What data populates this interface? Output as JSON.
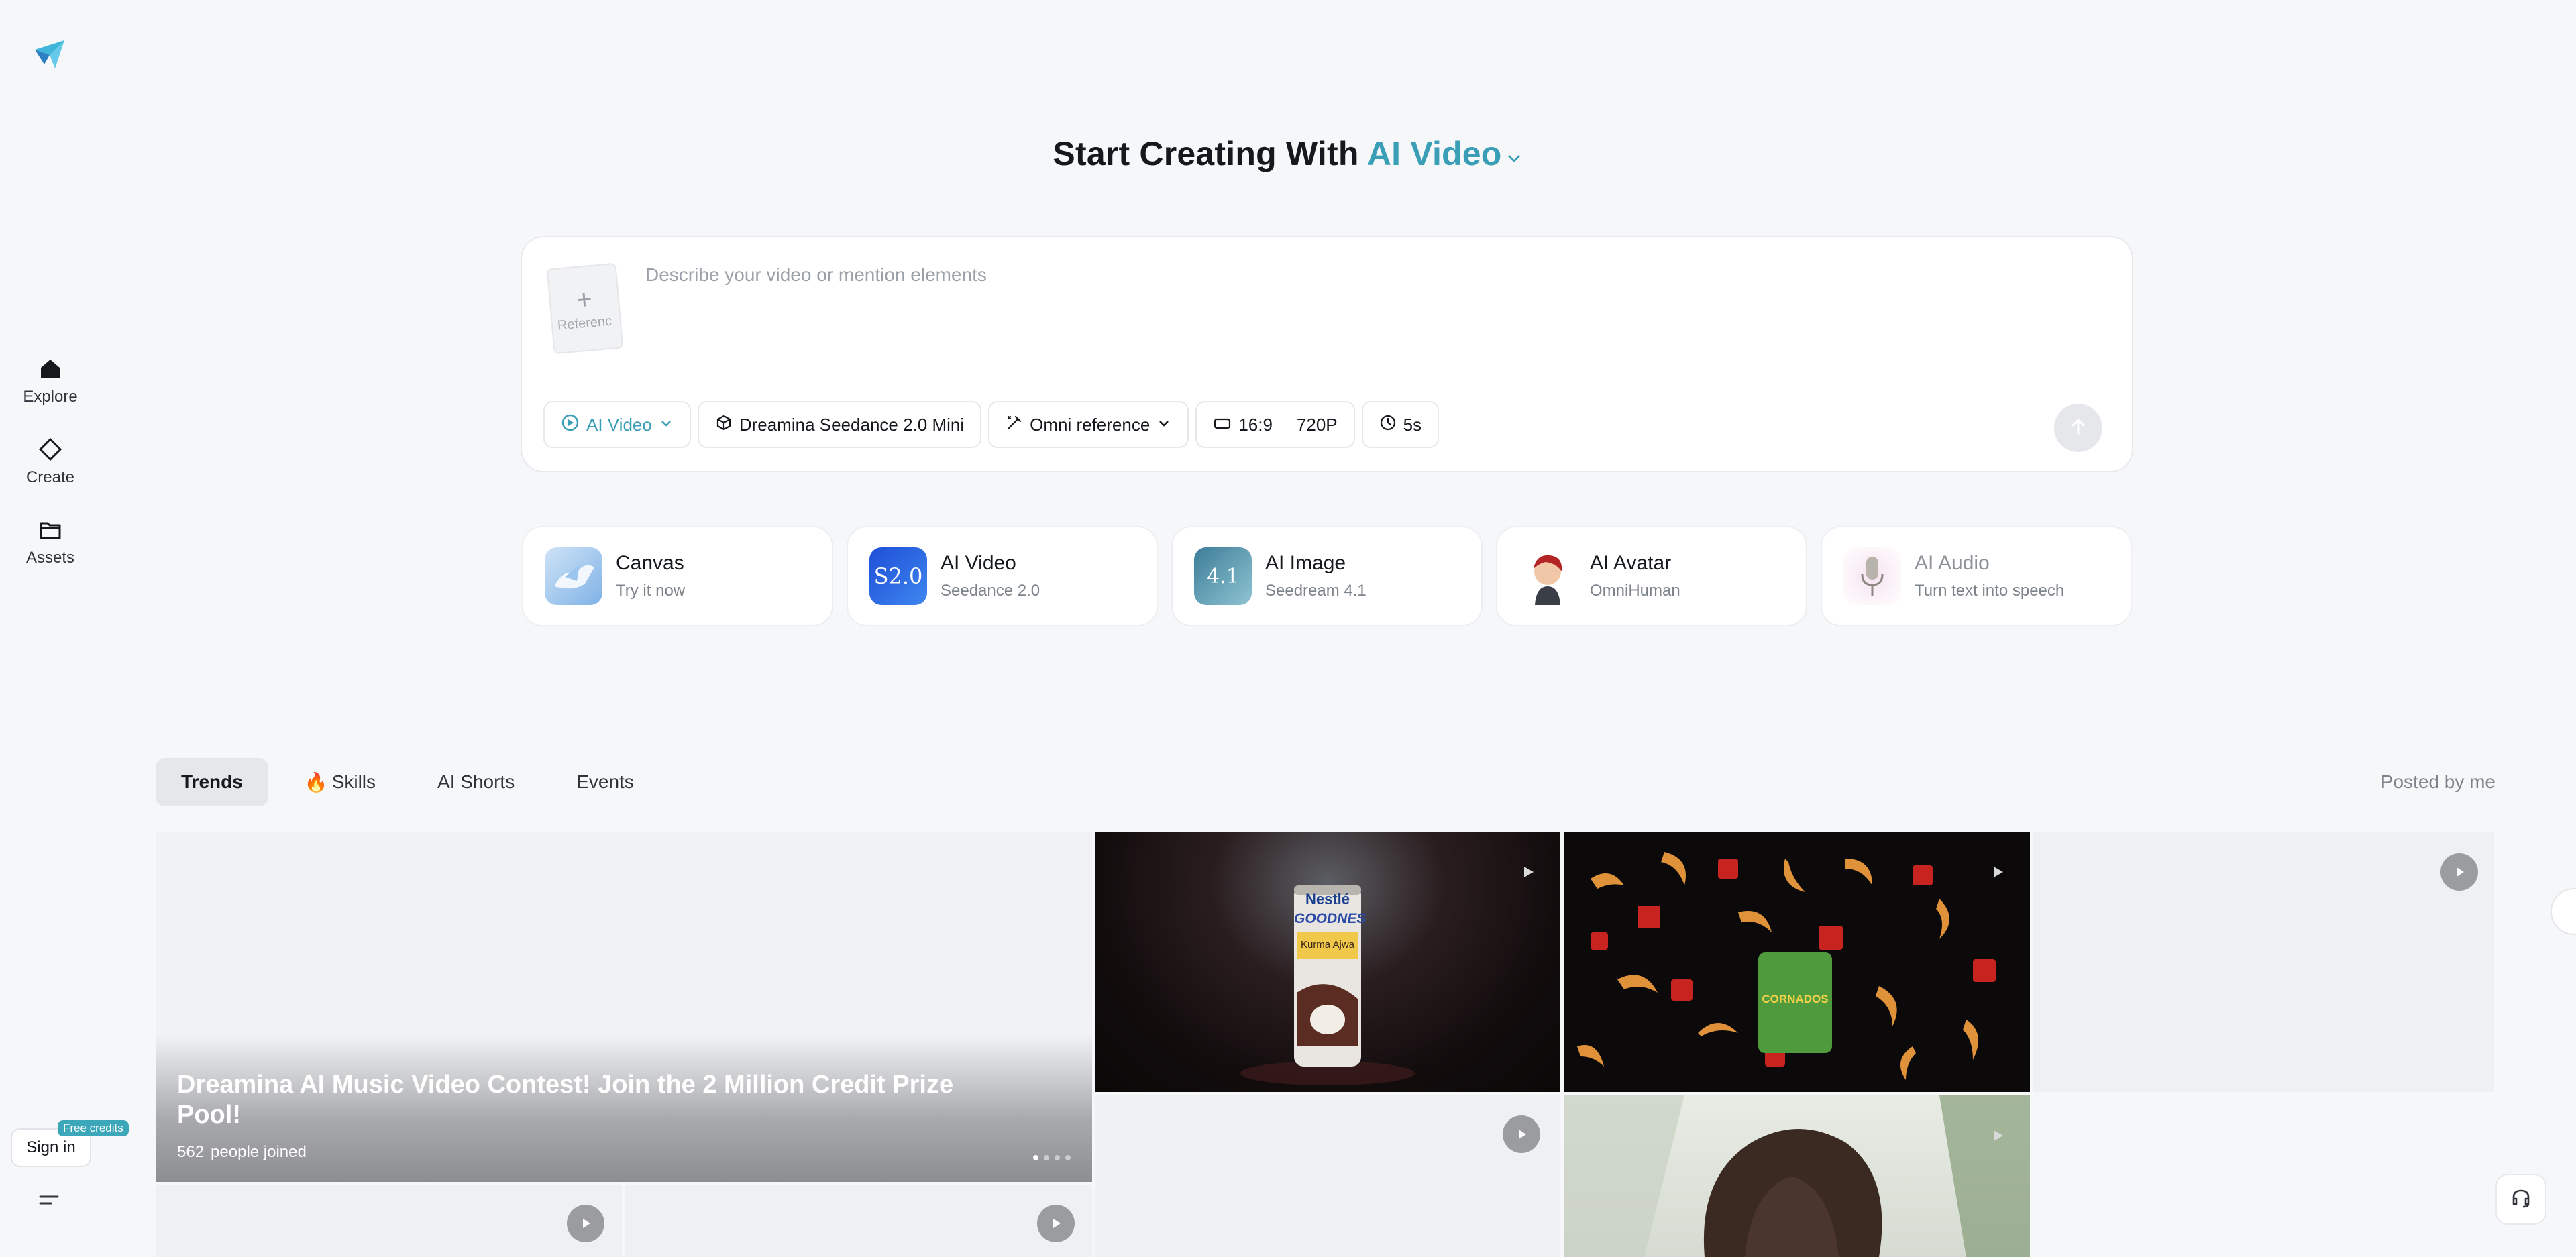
{
  "sidebar": {
    "items": [
      {
        "label": "Explore",
        "icon": "home-icon"
      },
      {
        "label": "Create",
        "icon": "diamond-icon"
      },
      {
        "label": "Assets",
        "icon": "folder-icon"
      }
    ],
    "signin_label": "Sign in",
    "free_badge": "Free credits"
  },
  "header": {
    "title_prefix": "Start Creating With",
    "title_accent": "AI Video"
  },
  "prompt": {
    "placeholder": "Describe your video or mention elements",
    "reference_label": "Referenc",
    "mode": "AI Video",
    "model": "Dreamina Seedance 2.0 Mini",
    "reference_mode": "Omni reference",
    "ratio": "16:9",
    "resolution": "720P",
    "duration": "5s"
  },
  "features": [
    {
      "title": "Canvas",
      "sub": "Try it now"
    },
    {
      "title": "AI Video",
      "sub": "Seedance 2.0",
      "thumb_text": "S2.0"
    },
    {
      "title": "AI Image",
      "sub": "Seedream 4.1",
      "thumb_text": "4.1"
    },
    {
      "title": "AI Avatar",
      "sub": "OmniHuman"
    },
    {
      "title": "AI Audio",
      "sub": "Turn text into speech"
    }
  ],
  "tabs": {
    "items": [
      "Trends",
      "Skills",
      "AI Shorts",
      "Events"
    ],
    "skills_emoji": "🔥",
    "posted_by_me": "Posted by me"
  },
  "banner": {
    "title": "Dreamina AI Music Video Contest! Join the 2 Million Credit Prize Pool!",
    "joined_count": "562",
    "joined_label": "people joined"
  },
  "gallery": {
    "can_brand": "Nestlé",
    "can_name": "GOODNES",
    "can_flavor": "Kurma Ajwa",
    "snack_brand": "CORNADOS"
  },
  "colors": {
    "accent": "#3a9fb6",
    "badge": "#3ba7b9",
    "background": "#f6f7f9"
  }
}
